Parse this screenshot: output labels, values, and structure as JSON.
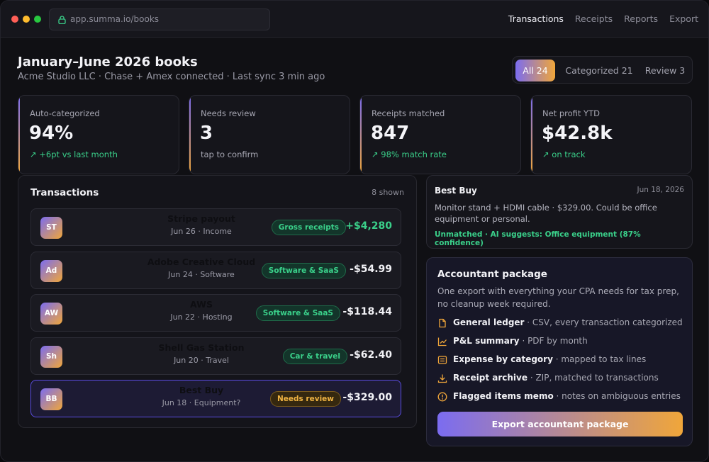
{
  "browser": {
    "url": "app.summa.io/books"
  },
  "nav": {
    "items": [
      "Transactions",
      "Receipts",
      "Reports",
      "Export"
    ],
    "active": 0
  },
  "header": {
    "title": "January–June 2026 books",
    "subtitle": "Acme Studio LLC · Chase + Amex connected · Last sync 3 min ago"
  },
  "filters": [
    {
      "label": "All 24",
      "active": true
    },
    {
      "label": "Categorized 21",
      "active": false
    },
    {
      "label": "Review 3",
      "active": false
    }
  ],
  "stats": [
    {
      "label": "Auto-categorized",
      "value": "94%",
      "note": "↗ +6pt vs last month",
      "note_color": "green"
    },
    {
      "label": "Needs review",
      "value": "3",
      "note": "tap to confirm",
      "note_color": "gray"
    },
    {
      "label": "Receipts matched",
      "value": "847",
      "note": "↗ 98% match rate",
      "note_color": "green"
    },
    {
      "label": "Net profit YTD",
      "value": "$42.8k",
      "note": "↗ on track",
      "note_color": "green"
    }
  ],
  "transactions": {
    "title": "Transactions",
    "count": "8 shown",
    "rows": [
      {
        "initials": "ST",
        "merchant": "Stripe payout",
        "meta": "Jun 26 · Income",
        "tag": "Gross receipts",
        "tag_style": "green",
        "amount": "+$4,280",
        "positive": true
      },
      {
        "initials": "Ad",
        "merchant": "Adobe Creative Cloud",
        "meta": "Jun 24 · Software",
        "tag": "Software & SaaS",
        "tag_style": "green",
        "amount": "-$54.99",
        "positive": false
      },
      {
        "initials": "AW",
        "merchant": "AWS",
        "meta": "Jun 22 · Hosting",
        "tag": "Software & SaaS",
        "tag_style": "green",
        "amount": "-$118.44",
        "positive": false
      },
      {
        "initials": "Sh",
        "merchant": "Shell Gas Station",
        "meta": "Jun 20 · Travel",
        "tag": "Car & travel",
        "tag_style": "green",
        "amount": "-$62.40",
        "positive": false
      },
      {
        "initials": "BB",
        "merchant": "Best Buy",
        "meta": "Jun 18 · Equipment?",
        "tag": "Needs review",
        "tag_style": "amber",
        "amount": "-$329.00",
        "positive": false,
        "selected": true
      }
    ]
  },
  "detail": {
    "merchant": "Best Buy",
    "date": "Jun 18, 2026",
    "description": "Monitor stand + HDMI cable · $329.00. Could be office equipment or personal.",
    "note": "Unmatched · AI suggests: Office equipment (87% confidence)"
  },
  "package": {
    "title": "Accountant package",
    "description": "One export with everything your CPA needs for tax prep, no cleanup week required.",
    "items": [
      {
        "icon": "document-icon",
        "name": "General ledger",
        "detail": " · CSV, every transaction categorized"
      },
      {
        "icon": "chart-icon",
        "name": "P&L summary",
        "detail": " · PDF by month"
      },
      {
        "icon": "list-icon",
        "name": "Expense by category",
        "detail": " · mapped to tax lines"
      },
      {
        "icon": "download-icon",
        "name": "Receipt archive",
        "detail": " · ZIP, matched to transactions"
      },
      {
        "icon": "alert-icon",
        "name": "Flagged items memo",
        "detail": " · notes on ambiguous entries"
      }
    ],
    "button": "Export accountant package"
  },
  "colors": {
    "accent_start": "#7b6cf0",
    "accent_end": "#f0a63a",
    "positive": "#3ad08a",
    "warning": "#f0b443"
  }
}
